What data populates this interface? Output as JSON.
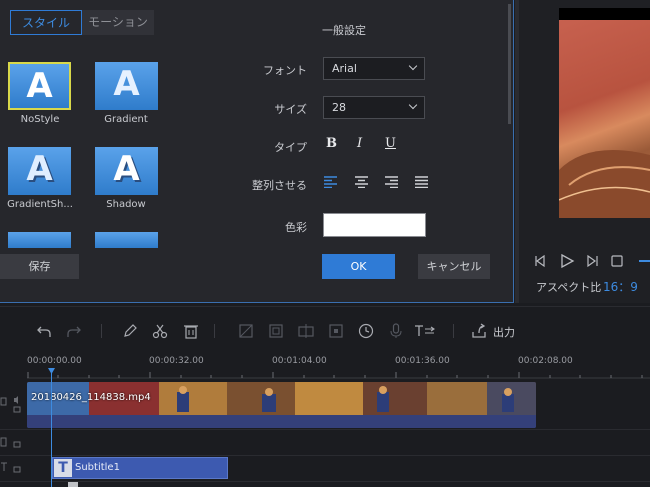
{
  "dialog": {
    "tabs": [
      "スタイル",
      "モーション"
    ],
    "section_title": "一般設定",
    "styles": [
      {
        "name": "NoStyle",
        "letter": "A"
      },
      {
        "name": "Gradient",
        "letter": "A"
      },
      {
        "name": "GradientSh...",
        "letter": "A"
      },
      {
        "name": "Shadow",
        "letter": "A"
      }
    ],
    "font_label": "フォント",
    "font_value": "Arial",
    "size_label": "サイズ",
    "size_value": "28",
    "type_label": "タイプ",
    "type_bold": "B",
    "type_italic": "I",
    "type_underline": "U",
    "align_label": "整列させる",
    "color_label": "色彩",
    "color_value": "#ffffff",
    "save_label": "保存",
    "ok_label": "OK",
    "cancel_label": "キャンセル"
  },
  "preview": {
    "aspect_label": "アスペクト比",
    "aspect_value": "16：9"
  },
  "toolbar": {
    "export_label": "出力"
  },
  "timeline": {
    "ticks": [
      "00:00:00.00",
      "00:00:32.00",
      "00:01:04.00",
      "00:01:36.00",
      "00:02:08.00"
    ],
    "video_clip": "20180426_114838.mp4",
    "subtitle_clip": "Subtitle1"
  },
  "colors": {
    "accent": "#2f7bd6",
    "ok_button": "#2f7bd6",
    "selected_border": "#d8d84a",
    "subtitle_clip": "#3d5ab0"
  }
}
